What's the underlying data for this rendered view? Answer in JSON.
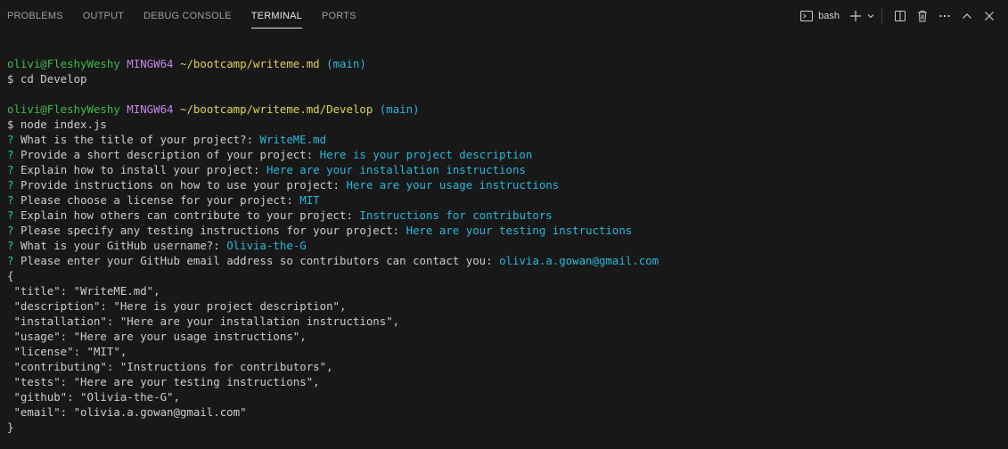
{
  "tabs": [
    {
      "label": "PROBLEMS",
      "active": false
    },
    {
      "label": "OUTPUT",
      "active": false
    },
    {
      "label": "DEBUG CONSOLE",
      "active": false
    },
    {
      "label": "TERMINAL",
      "active": true
    },
    {
      "label": "PORTS",
      "active": false
    }
  ],
  "toolbar": {
    "shell_label": "bash",
    "icons": [
      "terminal-icon",
      "plus-icon",
      "chevron-down-icon",
      "split-icon",
      "trash-icon",
      "more-icon",
      "chevron-up-icon",
      "close-icon"
    ]
  },
  "colors": {
    "background": "#181818",
    "user": "#3fb950",
    "host": "#c586e8",
    "path": "#dbd35b",
    "branch": "#29b8db",
    "question_mark": "#23d18b",
    "answer": "#29b8db"
  },
  "terminal": {
    "prompt1": {
      "user": "olivi@FleshyWeshy",
      "host": "MINGW64",
      "path": "~/bootcamp/writeme.md",
      "branch": "(main)"
    },
    "cmd1": "$ cd Develop",
    "prompt2": {
      "user": "olivi@FleshyWeshy",
      "host": "MINGW64",
      "path": "~/bootcamp/writeme.md/Develop",
      "branch": "(main)"
    },
    "cmd2": "$ node index.js",
    "qa": [
      {
        "q": "What is the title of your project?:",
        "a": "WriteME.md"
      },
      {
        "q": "Provide a short description of your project:",
        "a": "Here is your project description"
      },
      {
        "q": "Explain how to install your project:",
        "a": "Here are your installation instructions"
      },
      {
        "q": "Provide instructions on how to use your project:",
        "a": "Here are your usage instructions"
      },
      {
        "q": "Please choose a license for your project:",
        "a": "MIT"
      },
      {
        "q": "Explain how others can contribute to your project:",
        "a": "Instructions for contributors"
      },
      {
        "q": "Please specify any testing instructions for your project:",
        "a": "Here are your testing instructions"
      },
      {
        "q": "What is your GitHub username?:",
        "a": "Olivia-the-G"
      },
      {
        "q": "Please enter your GitHub email address so contributors can contact you:",
        "a": "olivia.a.gowan@gmail.com"
      }
    ],
    "json_output": [
      "{",
      " \"title\": \"WriteME.md\",",
      " \"description\": \"Here is your project description\",",
      " \"installation\": \"Here are your installation instructions\",",
      " \"usage\": \"Here are your usage instructions\",",
      " \"license\": \"MIT\",",
      " \"contributing\": \"Instructions for contributors\",",
      " \"tests\": \"Here are your testing instructions\",",
      " \"github\": \"Olivia-the-G\",",
      " \"email\": \"olivia.a.gowan@gmail.com\"",
      "}"
    ]
  }
}
